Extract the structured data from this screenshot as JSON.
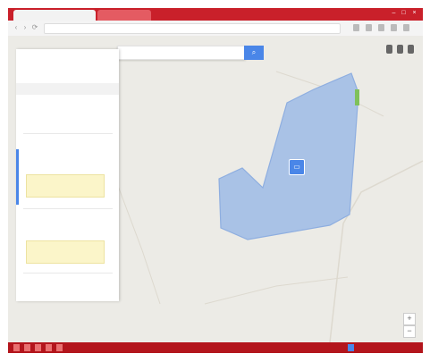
{
  "browser": {
    "tabs": [
      {
        "label": "",
        "active": true
      },
      {
        "label": "",
        "active": false
      }
    ],
    "url": "",
    "window_buttons": {
      "minimize": "–",
      "maximize": "□",
      "close": "×"
    },
    "nav_icons": {
      "back": "‹",
      "forward": "›",
      "reload": "⟳"
    }
  },
  "search": {
    "placeholder": "",
    "button_icon": "⌕"
  },
  "filters": [
    "",
    "",
    ""
  ],
  "sidebar": {
    "title": "",
    "subtitle": "",
    "header": "",
    "section1": {
      "line1": "",
      "line2": ""
    },
    "item1": {
      "title": "",
      "subtitle": "",
      "note": ""
    },
    "item2": {
      "title": "",
      "subtitle": "",
      "note": ""
    },
    "footer": ""
  },
  "map": {
    "label": "",
    "zoom_in": "+",
    "zoom_out": "−",
    "marker_icon": "▭"
  },
  "colors": {
    "polygon_fill": "#a9c2e6",
    "polygon_stroke": "#8eaee0",
    "accent": "#4a86e8",
    "chrome_red": "#c9202a",
    "map_bg": "#ecebe6"
  },
  "taskbar": {
    "time": ""
  }
}
